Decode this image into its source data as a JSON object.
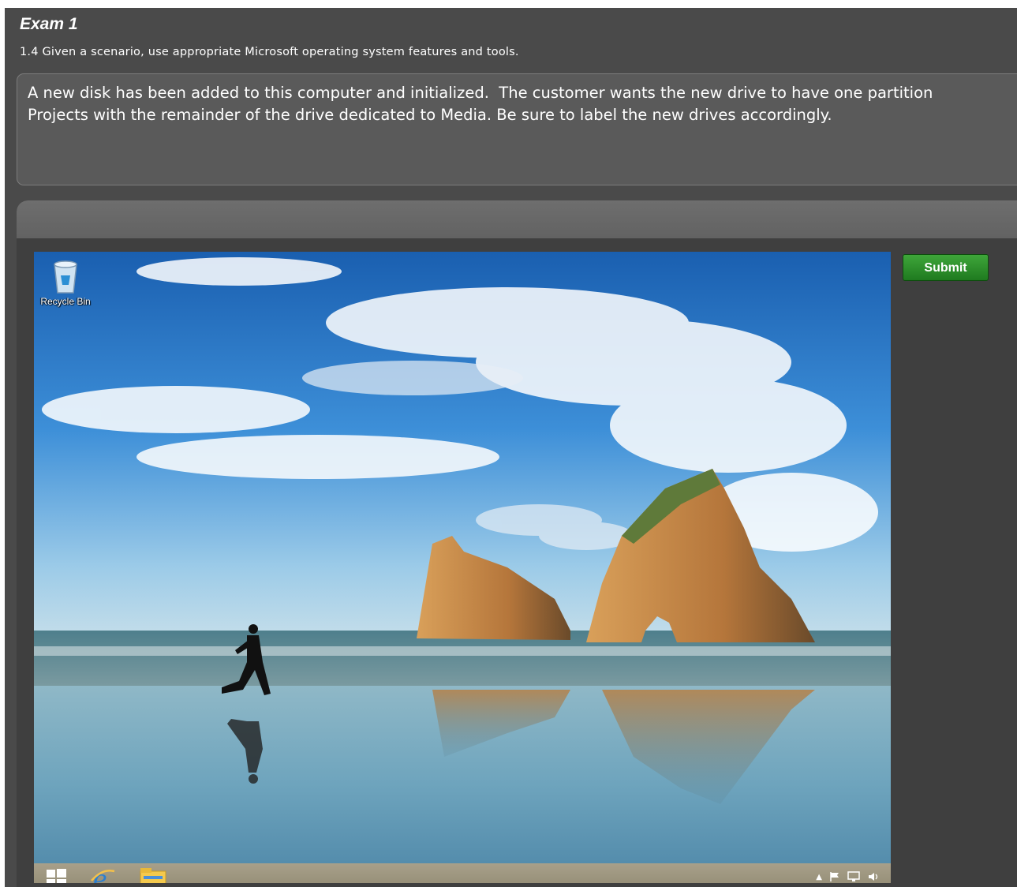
{
  "exam": {
    "title": "Exam 1",
    "objective": "1.4 Given a scenario, use appropriate Microsoft operating system features and tools.",
    "question": "A new disk has been added to this computer and initialized.  The customer wants the new drive to have one partition\nProjects with the remainder of the drive dedicated to Media. Be sure to label the new drives accordingly."
  },
  "simulation": {
    "submit_label": "Submit",
    "desktop": {
      "recycle_bin_label": "Recycle Bin",
      "taskbar_items": [
        "start-icon",
        "internet-explorer-icon",
        "file-explorer-icon"
      ],
      "tray_icons": [
        "chevron-up-icon",
        "flag-icon",
        "network-icon",
        "volume-icon"
      ]
    }
  },
  "colors": {
    "submit_green": "#2e8f2a",
    "panel_gray": "#4a4a4a"
  }
}
